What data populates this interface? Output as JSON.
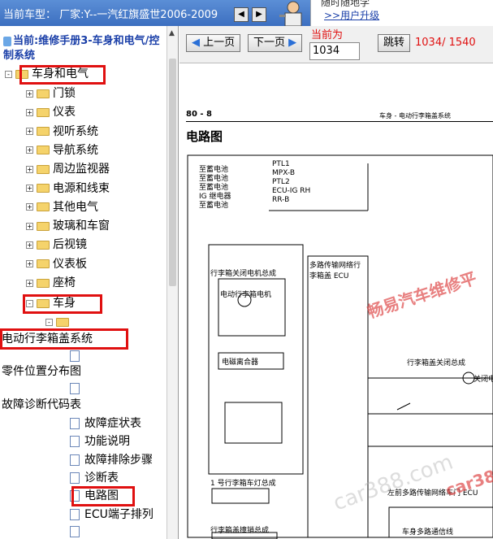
{
  "topbar": {
    "title": "当前车型：  厂家:Y--一汽红旗盛世2006-2009",
    "promo_line1": "随时随地学",
    "promo_line2": ">>用户升级"
  },
  "tree": {
    "manual_title": "当前:维修手册3-车身和电气/控制系统",
    "root": "车身和电气",
    "children": [
      "门锁",
      "仪表",
      "视听系统",
      "导航系统",
      "周边监视器",
      "电源和线束",
      "其他电气",
      "玻璃和车窗",
      "后视镜",
      "仪表板",
      "座椅"
    ],
    "body": "车身",
    "system": "电动行李箱盖系统",
    "parts_location": "零件位置分布图",
    "dtc": "故障诊断代码表",
    "leaves": [
      "故障症状表",
      "功能说明",
      "故障排除步骤",
      "诊断表",
      "电路图",
      "ECU端子排列"
    ]
  },
  "controls": {
    "prev": "上一页",
    "next": "下一页",
    "current_label": "当前为",
    "page_value": "1034",
    "jump": "跳转",
    "page_count": "1034/ 1540"
  },
  "document": {
    "page_no": "80 - 8",
    "header": "车身  -  电动行李箱盖系统",
    "title": "电路图",
    "power_sources": [
      "至蓄电池",
      "至蓄电池",
      "至蓄电池",
      "IG 继电器",
      "至蓄电池"
    ],
    "power_pins": [
      "PTL1",
      "MPX-B",
      "PTL2",
      "ECU-IG RH",
      "RR-B"
    ],
    "closer_assembly": "行李箱关闭电机总成",
    "ecu": "多路传输网络行李箱盖 ECU",
    "motor": "电动行李箱电机",
    "clutch": "电磁离合器",
    "right_assembly": "行李箱盖关闭总成",
    "right_motor": "关闭电机",
    "lamp": "1 号行李箱车灯总成",
    "unlock": "行李箱盖撞销总成",
    "door_ecu": "左前多路传输网络车门 ECU",
    "bus": "车身多路通信线",
    "watermarks": [
      "畅易汽车维修平",
      "car388.com",
      "car388.c"
    ]
  }
}
